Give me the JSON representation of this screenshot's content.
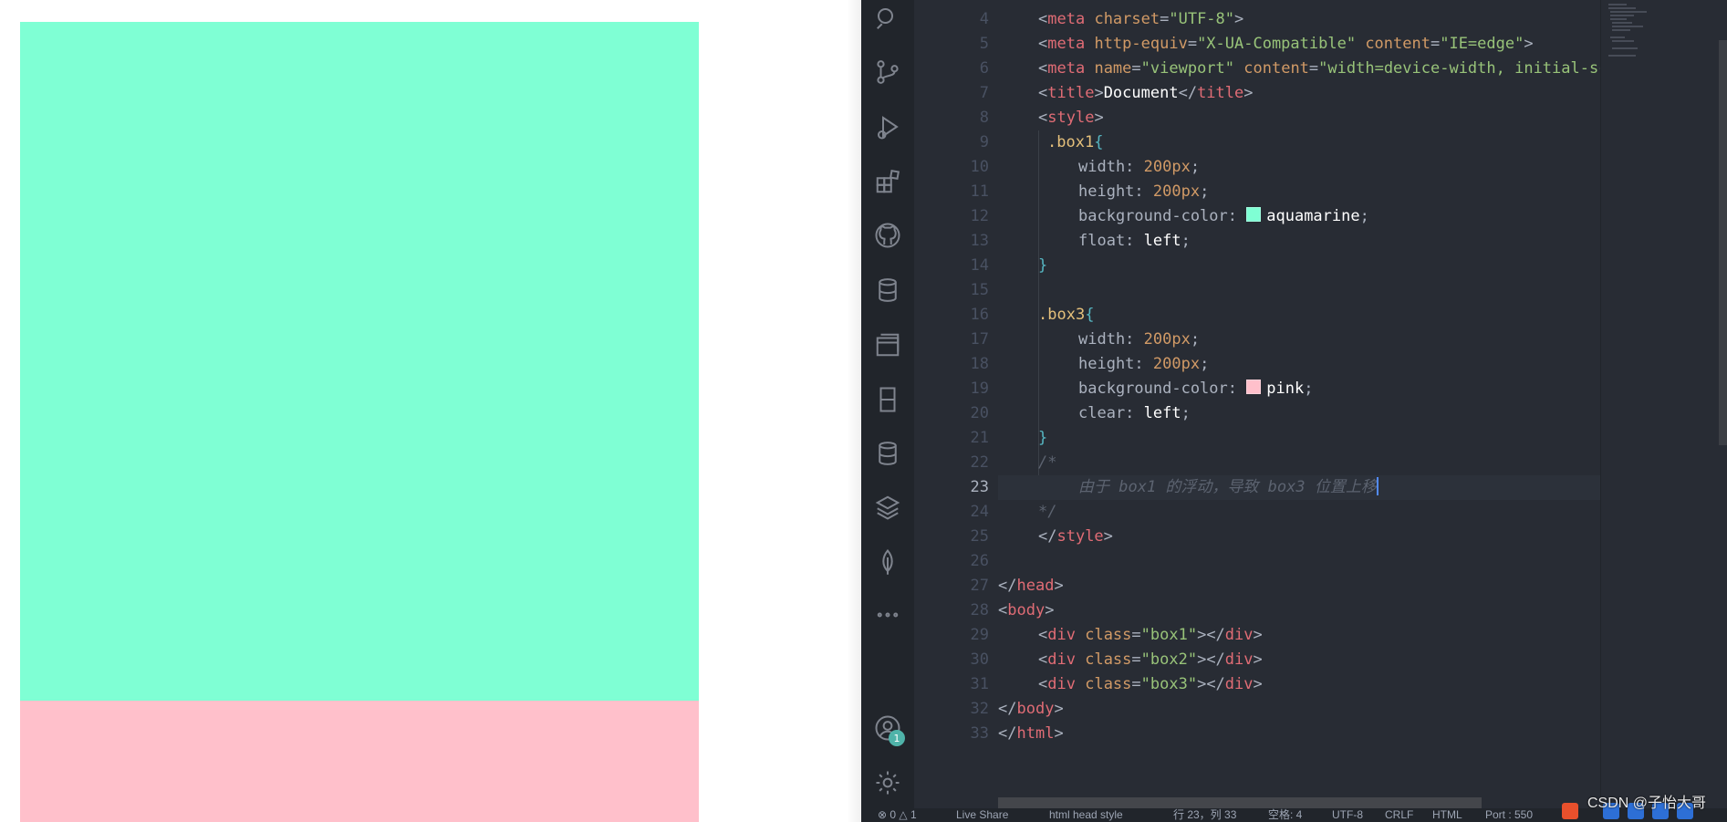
{
  "preview": {
    "box1_color": "#7fffd4",
    "box3_color": "#ffc0cb"
  },
  "activity_bar": {
    "icons": [
      "search-icon",
      "source-control-icon",
      "run-debug-icon",
      "extensions-icon",
      "github-icon",
      "database-icon",
      "remote-explorer-icon",
      "device-icon",
      "database-alt-icon",
      "layers-icon",
      "leaf-icon",
      "more-icon"
    ],
    "account_badge": "1"
  },
  "editor": {
    "active_line": "23",
    "lines": [
      {
        "n": "4"
      },
      {
        "n": "5"
      },
      {
        "n": "6"
      },
      {
        "n": "7"
      },
      {
        "n": "8"
      },
      {
        "n": "9"
      },
      {
        "n": "10"
      },
      {
        "n": "11"
      },
      {
        "n": "12"
      },
      {
        "n": "13"
      },
      {
        "n": "14"
      },
      {
        "n": "15"
      },
      {
        "n": "16"
      },
      {
        "n": "17"
      },
      {
        "n": "18"
      },
      {
        "n": "19"
      },
      {
        "n": "20"
      },
      {
        "n": "21"
      },
      {
        "n": "22"
      },
      {
        "n": "23"
      },
      {
        "n": "24"
      },
      {
        "n": "25"
      },
      {
        "n": "26"
      },
      {
        "n": "27"
      },
      {
        "n": "28"
      },
      {
        "n": "29"
      },
      {
        "n": "30"
      },
      {
        "n": "31"
      },
      {
        "n": "32"
      },
      {
        "n": "33"
      }
    ],
    "code": {
      "l4_tag": "meta",
      "l4_attr": "charset",
      "l4_val": "\"UTF-8\"",
      "l5_tag": "meta",
      "l5_attr1": "http-equiv",
      "l5_val1": "\"X-UA-Compatible\"",
      "l5_attr2": "content",
      "l5_val2": "\"IE=edge\"",
      "l6_tag": "meta",
      "l6_attr1": "name",
      "l6_val1": "\"viewport\"",
      "l6_attr2": "content",
      "l6_val2": "\"width=device-width, initial-sca",
      "l7_tag": "title",
      "l7_text": "Document",
      "l8_tag": "style",
      "l9_sel": ".box1",
      "l10_prop": "width:",
      "l10_val": "200px",
      "l11_prop": "height:",
      "l11_val": "200px",
      "l12_prop": "background-color:",
      "l12_val": "aquamarine",
      "l13_prop": "float:",
      "l13_val": "left",
      "l16_sel": ".box3",
      "l17_prop": "width:",
      "l17_val": "200px",
      "l18_prop": "height:",
      "l18_val": "200px",
      "l19_prop": "background-color:",
      "l19_val": "pink",
      "l20_prop": "clear:",
      "l20_val": "left",
      "l22_comment": "/*",
      "l23_comment": "由于 box1 的浮动，导致 box3 位置上移",
      "l24_comment": "*/",
      "l25_tag": "style",
      "l27_tag": "head",
      "l28_tag": "body",
      "l29_tag": "div",
      "l29_attr": "class",
      "l29_val": "\"box1\"",
      "l30_tag": "div",
      "l30_attr": "class",
      "l30_val": "\"box2\"",
      "l31_tag": "div",
      "l31_attr": "class",
      "l31_val": "\"box3\"",
      "l32_tag": "body",
      "l33_tag": "html"
    },
    "swatch_aquamarine": "#7fffd4",
    "swatch_pink": "#ffc0cb"
  },
  "statusbar": {
    "problems": "⊗ 0 △ 1",
    "live_share": "Live Share",
    "breadcrumb": "html  head  style",
    "position": "行 23，列 33",
    "spaces": "空格: 4",
    "encoding": "UTF-8",
    "eol": "CRLF",
    "language": "HTML",
    "port": "Port : 550"
  },
  "watermark": "CSDN @子怡大哥"
}
